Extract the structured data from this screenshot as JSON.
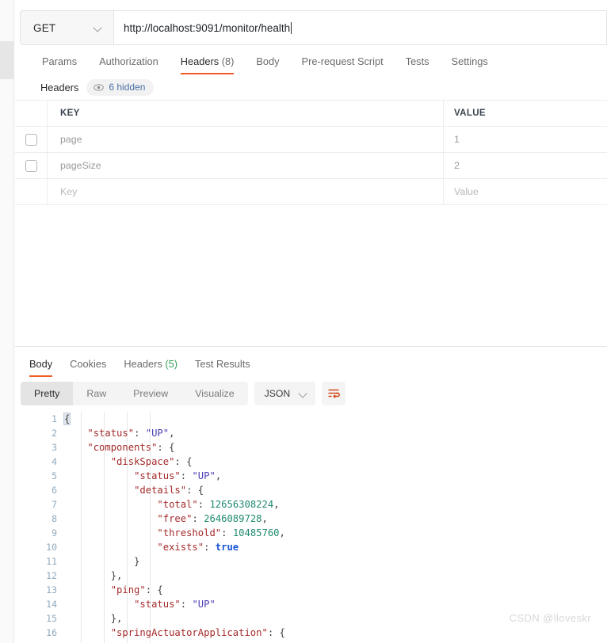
{
  "request": {
    "method": "GET",
    "url": "http://localhost:9091/monitor/health",
    "tabs": [
      {
        "label": "Params",
        "count": "",
        "active": false
      },
      {
        "label": "Authorization",
        "count": "",
        "active": false
      },
      {
        "label": "Headers",
        "count": "(8)",
        "active": true
      },
      {
        "label": "Body",
        "count": "",
        "active": false
      },
      {
        "label": "Pre-request Script",
        "count": "",
        "active": false
      },
      {
        "label": "Tests",
        "count": "",
        "active": false
      },
      {
        "label": "Settings",
        "count": "",
        "active": false
      }
    ],
    "headers_section": {
      "label": "Headers",
      "hidden_badge": "6 hidden",
      "eye_icon": "eye-icon"
    },
    "table": {
      "columns": [
        "KEY",
        "VALUE"
      ],
      "rows": [
        {
          "checked": false,
          "key": "page",
          "value": "1",
          "placeholder": false
        },
        {
          "checked": false,
          "key": "pageSize",
          "value": "2",
          "placeholder": false
        },
        {
          "checked": null,
          "key": "Key",
          "value": "Value",
          "placeholder": true
        }
      ]
    }
  },
  "response": {
    "tabs": [
      {
        "label": "Body",
        "count": "",
        "active": true
      },
      {
        "label": "Cookies",
        "count": "",
        "active": false
      },
      {
        "label": "Headers",
        "count": "(5)",
        "active": false
      },
      {
        "label": "Test Results",
        "count": "",
        "active": false
      }
    ],
    "view_modes": [
      {
        "label": "Pretty",
        "active": true
      },
      {
        "label": "Raw",
        "active": false
      },
      {
        "label": "Preview",
        "active": false
      },
      {
        "label": "Visualize",
        "active": false
      }
    ],
    "format": {
      "label": "JSON",
      "icon": "chevron-down-icon"
    },
    "wrap_button_icon": "word-wrap-icon",
    "accent_color": "#ef5b25",
    "body_lines": [
      {
        "n": "1",
        "indent": 0,
        "tokens": [
          {
            "t": "punct",
            "v": "{"
          }
        ],
        "selected": true
      },
      {
        "n": "2",
        "indent": 1,
        "tokens": [
          {
            "t": "key",
            "v": "\"status\""
          },
          {
            "t": "punct",
            "v": ": "
          },
          {
            "t": "str",
            "v": "\"UP\""
          },
          {
            "t": "punct",
            "v": ","
          }
        ]
      },
      {
        "n": "3",
        "indent": 1,
        "tokens": [
          {
            "t": "key",
            "v": "\"components\""
          },
          {
            "t": "punct",
            "v": ": {"
          }
        ]
      },
      {
        "n": "4",
        "indent": 2,
        "tokens": [
          {
            "t": "key",
            "v": "\"diskSpace\""
          },
          {
            "t": "punct",
            "v": ": {"
          }
        ]
      },
      {
        "n": "5",
        "indent": 3,
        "tokens": [
          {
            "t": "key",
            "v": "\"status\""
          },
          {
            "t": "punct",
            "v": ": "
          },
          {
            "t": "str",
            "v": "\"UP\""
          },
          {
            "t": "punct",
            "v": ","
          }
        ]
      },
      {
        "n": "6",
        "indent": 3,
        "tokens": [
          {
            "t": "key",
            "v": "\"details\""
          },
          {
            "t": "punct",
            "v": ": {"
          }
        ]
      },
      {
        "n": "7",
        "indent": 4,
        "tokens": [
          {
            "t": "key",
            "v": "\"total\""
          },
          {
            "t": "punct",
            "v": ": "
          },
          {
            "t": "num",
            "v": "12656308224"
          },
          {
            "t": "punct",
            "v": ","
          }
        ]
      },
      {
        "n": "8",
        "indent": 4,
        "tokens": [
          {
            "t": "key",
            "v": "\"free\""
          },
          {
            "t": "punct",
            "v": ": "
          },
          {
            "t": "num",
            "v": "2646089728"
          },
          {
            "t": "punct",
            "v": ","
          }
        ]
      },
      {
        "n": "9",
        "indent": 4,
        "tokens": [
          {
            "t": "key",
            "v": "\"threshold\""
          },
          {
            "t": "punct",
            "v": ": "
          },
          {
            "t": "num",
            "v": "10485760"
          },
          {
            "t": "punct",
            "v": ","
          }
        ]
      },
      {
        "n": "10",
        "indent": 4,
        "tokens": [
          {
            "t": "key",
            "v": "\"exists\""
          },
          {
            "t": "punct",
            "v": ": "
          },
          {
            "t": "bool",
            "v": "true"
          }
        ]
      },
      {
        "n": "11",
        "indent": 3,
        "tokens": [
          {
            "t": "punct",
            "v": "}"
          }
        ]
      },
      {
        "n": "12",
        "indent": 2,
        "tokens": [
          {
            "t": "punct",
            "v": "},"
          }
        ]
      },
      {
        "n": "13",
        "indent": 2,
        "tokens": [
          {
            "t": "key",
            "v": "\"ping\""
          },
          {
            "t": "punct",
            "v": ": {"
          }
        ]
      },
      {
        "n": "14",
        "indent": 3,
        "tokens": [
          {
            "t": "key",
            "v": "\"status\""
          },
          {
            "t": "punct",
            "v": ": "
          },
          {
            "t": "str",
            "v": "\"UP\""
          }
        ]
      },
      {
        "n": "15",
        "indent": 2,
        "tokens": [
          {
            "t": "punct",
            "v": "},"
          }
        ]
      },
      {
        "n": "16",
        "indent": 2,
        "tokens": [
          {
            "t": "key",
            "v": "\"springActuatorApplication\""
          },
          {
            "t": "punct",
            "v": ": {"
          }
        ]
      }
    ]
  },
  "watermark": "CSDN @lloveskr"
}
